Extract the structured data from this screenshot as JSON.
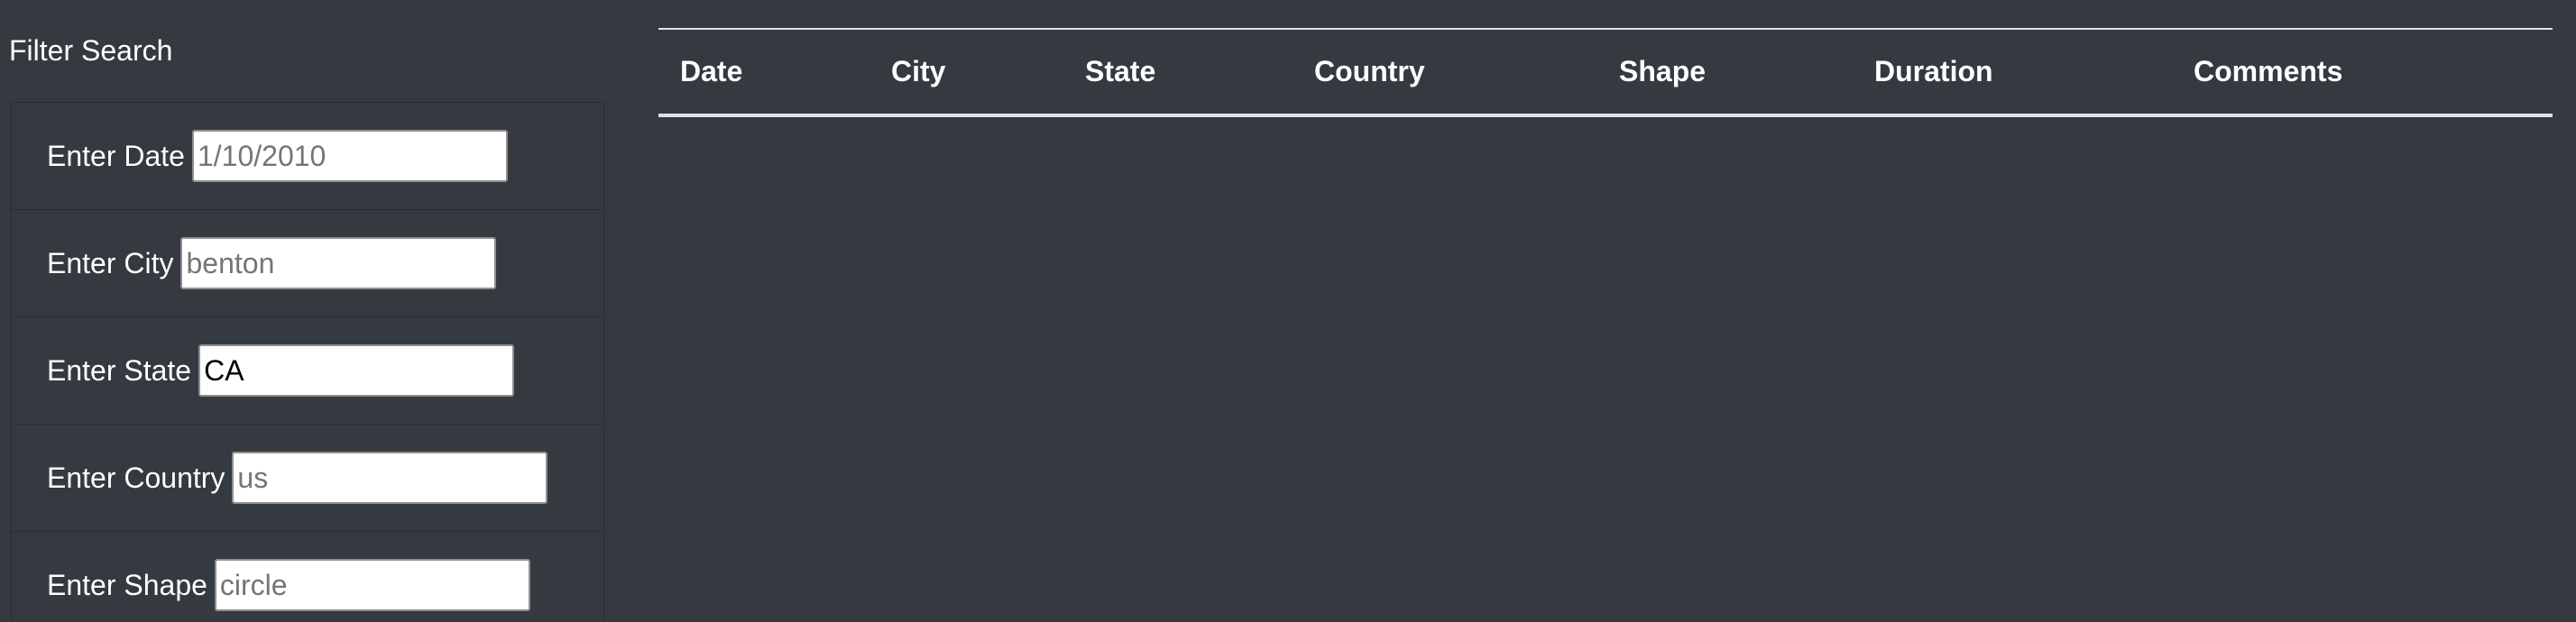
{
  "sidebar": {
    "title": "Filter Search",
    "filters": [
      {
        "label": "Enter Date",
        "value": "",
        "placeholder": "1/10/2010"
      },
      {
        "label": "Enter City",
        "value": "",
        "placeholder": "benton"
      },
      {
        "label": "Enter State",
        "value": "CA",
        "placeholder": ""
      },
      {
        "label": "Enter Country",
        "value": "",
        "placeholder": "us"
      },
      {
        "label": "Enter Shape",
        "value": "",
        "placeholder": "circle"
      }
    ]
  },
  "table": {
    "headers": [
      "Date",
      "City",
      "State",
      "Country",
      "Shape",
      "Duration",
      "Comments"
    ]
  }
}
